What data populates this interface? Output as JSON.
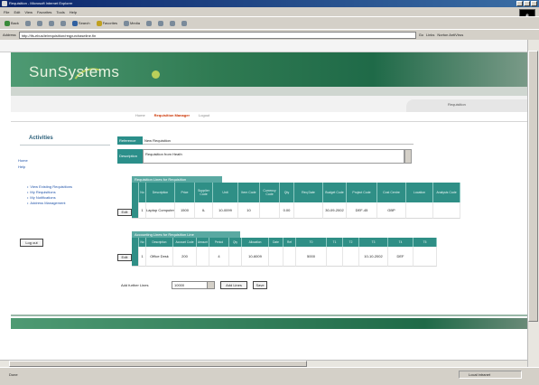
{
  "window": {
    "title": "Requisition - Microsoft Internet Explorer"
  },
  "menu": [
    "File",
    "Edit",
    "View",
    "Favorites",
    "Tools",
    "Help"
  ],
  "toolbar": {
    "back": "Back",
    "search": "Search",
    "favorites": "Favorites",
    "media": "Media"
  },
  "address": {
    "label": "Address",
    "url": "http://ifs-ebus/ie/requisition/reqpurchaseline.fin",
    "go": "Go",
    "links": "Links",
    "norton": "Norton AntiVirus"
  },
  "brand": {
    "name": "SunSystems"
  },
  "nav": {
    "link1": "Home",
    "link2": "Requisition Manager",
    "link3": "Logout",
    "tab": "Requisition"
  },
  "sidebar": {
    "title": "Activities",
    "links": [
      "Home",
      "Help"
    ],
    "bullets": [
      "View Existing Requisitions",
      "My Requisitions",
      "My Notifications",
      "Address Management"
    ],
    "logout": "Log out"
  },
  "form": {
    "name_label": "Reference",
    "name_value": "New Requisition",
    "desc_label": "Description",
    "desc_value": "Requisition from Heath"
  },
  "table1": {
    "caption": "Requisition Lines for Requisition",
    "headers": [
      "",
      "No",
      "Description",
      "Price",
      "Supplier Code",
      "Unit",
      "Item Code",
      "Currency Code",
      "Qty",
      "Req Date",
      "Budget Code",
      "Project Code",
      "Cost Centre",
      "Location",
      "Analysis Code"
    ],
    "row": [
      "",
      "1",
      "Laptop Computer",
      "1500",
      "IL",
      "10-0099",
      "10",
      "",
      "0.00",
      "",
      "30-09-2002",
      "DEF-45",
      "GBP",
      ""
    ],
    "button": "Edit"
  },
  "table2": {
    "caption": "Accounting Lines for Requisition Line",
    "headers": [
      "",
      "No",
      "Description",
      "Account Code",
      "Amount",
      "Period",
      "Qty",
      "Allocation",
      "Date",
      "Ref",
      "T0",
      "T1",
      "T2",
      "T3",
      "T4",
      "T5"
    ],
    "row": [
      "",
      "1",
      "Office Desk",
      "200",
      "",
      "4",
      "",
      "10-6009",
      "",
      "",
      "5000",
      "",
      "",
      "10-10-2002",
      "DEF",
      ""
    ],
    "button": "Edit"
  },
  "actions": {
    "add_label": "Add further Lines",
    "select_value": "10000",
    "submit": "Add Lines",
    "clear": "Save"
  },
  "status": {
    "text": "Done",
    "zone": "Local intranet"
  }
}
